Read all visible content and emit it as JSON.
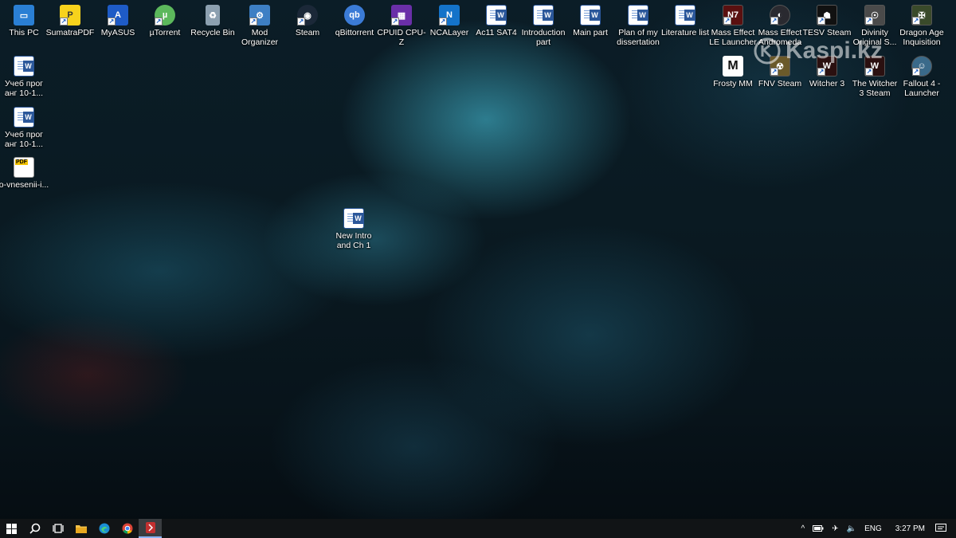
{
  "desktop": {
    "icons": [
      {
        "label": "This PC",
        "icon": "this-pc-icon"
      },
      {
        "label": "SumatraPDF",
        "icon": "sumatrapdf-icon"
      },
      {
        "label": "MyASUS",
        "icon": "myasus-icon"
      },
      {
        "label": "µTorrent",
        "icon": "utorrent-icon"
      },
      {
        "label": "Recycle Bin",
        "icon": "recycle-bin-icon"
      },
      {
        "label": "Mod Organizer",
        "icon": "mod-organizer-icon"
      },
      {
        "label": "Steam",
        "icon": "steam-icon"
      },
      {
        "label": "qBittorrent",
        "icon": "qbittorrent-icon"
      },
      {
        "label": "CPUID CPU-Z",
        "icon": "cpuz-icon"
      },
      {
        "label": "NCALayer",
        "icon": "ncalayer-icon"
      },
      {
        "label": "Ac11 SAT4",
        "icon": "word-doc-icon"
      },
      {
        "label": "Introduction part",
        "icon": "word-doc-icon"
      },
      {
        "label": "Main part",
        "icon": "word-doc-icon"
      },
      {
        "label": "Plan of my dissertation",
        "icon": "word-doc-icon"
      },
      {
        "label": "Literature list",
        "icon": "word-doc-icon"
      },
      {
        "label": "Mass Effect LE Launcher",
        "icon": "mass-effect-le-icon"
      },
      {
        "label": "Mass Effect Andromeda",
        "icon": "mass-effect-andromeda-icon"
      },
      {
        "label": "TESV Steam",
        "icon": "skyrim-icon"
      },
      {
        "label": "Divinity Original S...",
        "icon": "divinity-icon"
      },
      {
        "label": "Dragon Age Inquisition",
        "icon": "dragon-age-icon"
      },
      {
        "label": "Учеб прог анг 10-1...",
        "icon": "word-doc-icon"
      },
      {
        "label": "Учеб прог анг 10-1...",
        "icon": "word-doc-icon"
      },
      {
        "label": "o-vnesenii-i...",
        "icon": "pdf-doc-icon"
      },
      {
        "label": "New Intro and Ch 1",
        "icon": "word-doc-icon"
      },
      {
        "label": "Frosty MM",
        "icon": "frosty-mm-icon"
      },
      {
        "label": "FNV Steam",
        "icon": "fallout-nv-icon"
      },
      {
        "label": "Witcher 3",
        "icon": "witcher-icon"
      },
      {
        "label": "The Witcher 3 Steam",
        "icon": "witcher-icon"
      },
      {
        "label": "Fallout 4 - Launcher",
        "icon": "fallout4-icon"
      }
    ]
  },
  "watermark": {
    "text": "Kaspi.kz"
  },
  "taskbar": {
    "language": "ENG",
    "time": "3:27 PM"
  },
  "colors": {
    "taskbar_bg": "#111416",
    "word_blue": "#2b579a",
    "label_text": "#ffffff"
  }
}
